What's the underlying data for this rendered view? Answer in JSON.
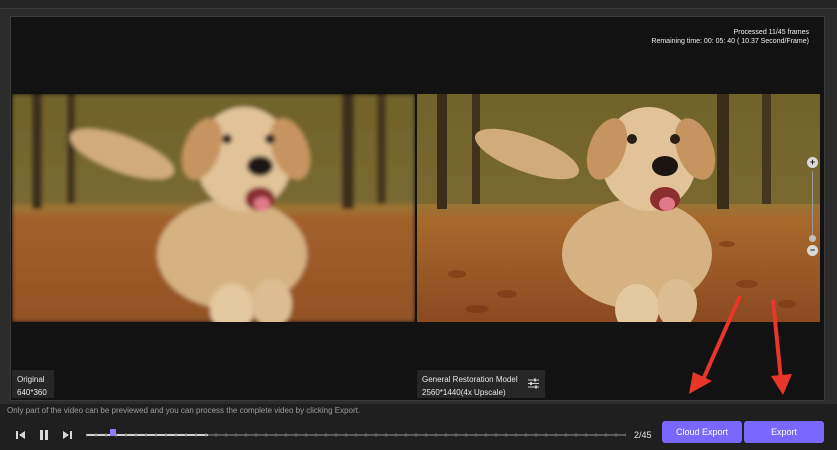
{
  "status": {
    "processed": "Processed 11/45 frames",
    "remaining": "Remaining time: 00: 05: 40 ( 10.37 Second/Frame)"
  },
  "original": {
    "title": "Original",
    "resolution": "640*360"
  },
  "enhanced": {
    "title": "General Restoration Model",
    "resolution": "2560*1440(4x Upscale)"
  },
  "notice": "Only part of the video can be previewed and you can process the complete video by clicking Export.",
  "player": {
    "frame_count": "2/45",
    "progress": 0.05,
    "buffered": 0.225
  },
  "buttons": {
    "cloud_export": "Cloud Export",
    "export": "Export"
  },
  "colors": {
    "accent": "#7a67ff",
    "arrow": "#e8362b"
  },
  "icons": [
    "previous-frame-icon",
    "pause-icon",
    "next-frame-icon",
    "settings-sliders-icon",
    "zoom-in-icon",
    "zoom-out-icon"
  ]
}
